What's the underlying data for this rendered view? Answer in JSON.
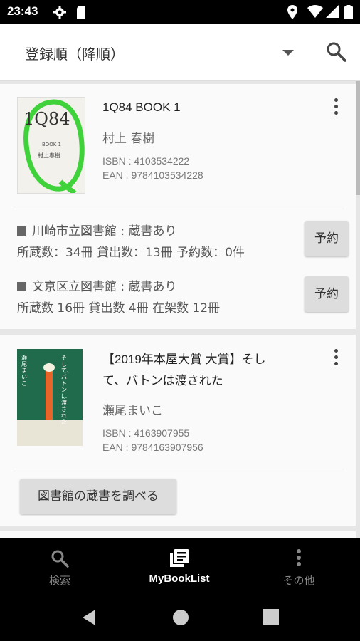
{
  "status_bar": {
    "time": "23:43"
  },
  "toolbar": {
    "sort_label": "登録順（降順）"
  },
  "books": [
    {
      "title": "1Q84 BOOK 1",
      "author": "村上 春樹",
      "isbn": "ISBN : 4103534222",
      "ean": "EAN : 9784103534228",
      "cover": {
        "big_text": "1Q84",
        "sub_text": "BOOK 1",
        "author": "村上春樹"
      },
      "libraries": [
        {
          "name": "川崎市立図書館 : 蔵書あり",
          "stats": "所蔵数：34冊 貸出数：13冊 予約数：0件",
          "button": "予約"
        },
        {
          "name": "文京区立図書館 : 蔵書あり",
          "stats": "所蔵数 16冊 貸出数 4冊 在架数 12冊",
          "button": "予約"
        }
      ]
    },
    {
      "title_line1": "【2019年本屋大賞 大賞】そし",
      "title_line2": "て、バトンは渡された",
      "author": "瀬尾まいこ",
      "isbn": "ISBN : 4163907955",
      "ean": "EAN : 9784163907956",
      "cover": {
        "side_text": "そして、バトンは渡された",
        "author": "瀬尾まいこ"
      },
      "lookup_button": "図書館の蔵書を調べる"
    }
  ],
  "bottom_nav": [
    {
      "label": "検索",
      "icon": "search-icon",
      "active": false
    },
    {
      "label": "MyBookList",
      "icon": "list-icon",
      "active": true
    },
    {
      "label": "その他",
      "icon": "more-vert-icon",
      "active": false
    }
  ],
  "colors": {
    "cover1_green": "#3fd23a",
    "cover2_bg": "#1f6b4c",
    "cover2_orange": "#e8652a"
  }
}
